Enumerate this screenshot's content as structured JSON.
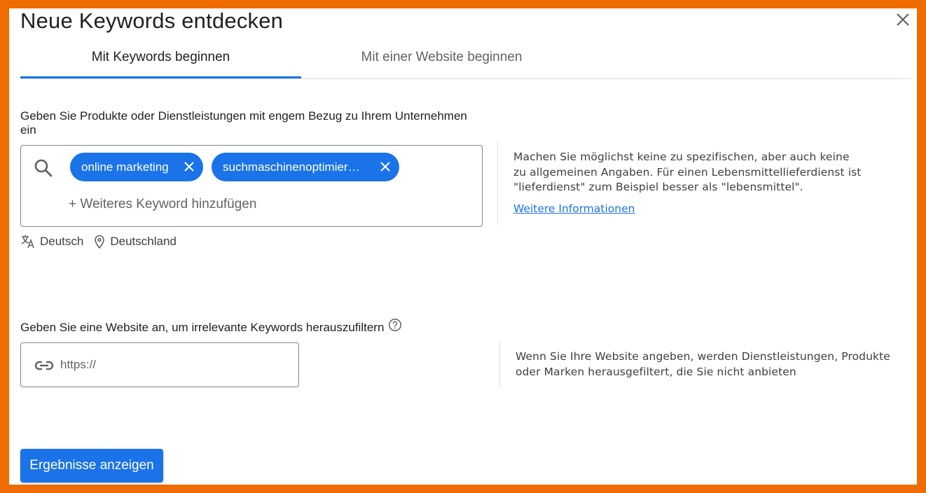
{
  "dialog": {
    "title": "Neue Keywords entdecken",
    "close_icon": "close-icon"
  },
  "tabs": [
    {
      "label": "Mit Keywords beginnen",
      "active": true
    },
    {
      "label": "Mit einer Website beginnen",
      "active": false
    }
  ],
  "keywords_section": {
    "label": "Geben Sie Produkte oder Dienstleistungen mit engem Bezug zu Ihrem Unternehmen ein",
    "chips": [
      {
        "text": "online marketing"
      },
      {
        "text": "suchmaschinenoptimier…"
      }
    ],
    "add_placeholder": "+ Weiteres Keyword hinzufügen",
    "language": "Deutsch",
    "location": "Deutschland",
    "help_text": "Machen Sie möglichst keine zu spezifischen, aber auch keine zu allgemeinen Angaben. Für einen Lebensmittellieferdienst ist \"lieferdienst\" zum Beispiel besser als \"lebensmittel\".",
    "help_link": "Weitere Informationen"
  },
  "website_section": {
    "label": "Geben Sie eine Website an, um irrelevante Keywords herauszufiltern",
    "url_placeholder": "https://",
    "url_value": "",
    "help_text": "Wenn Sie Ihre Website angeben, werden Dienstleistungen, Produkte oder Marken herausgefiltert, die Sie nicht anbieten"
  },
  "actions": {
    "submit_label": "Ergebnisse anzeigen"
  },
  "colors": {
    "accent": "#1a73e8",
    "frame": "#ef6c00"
  }
}
